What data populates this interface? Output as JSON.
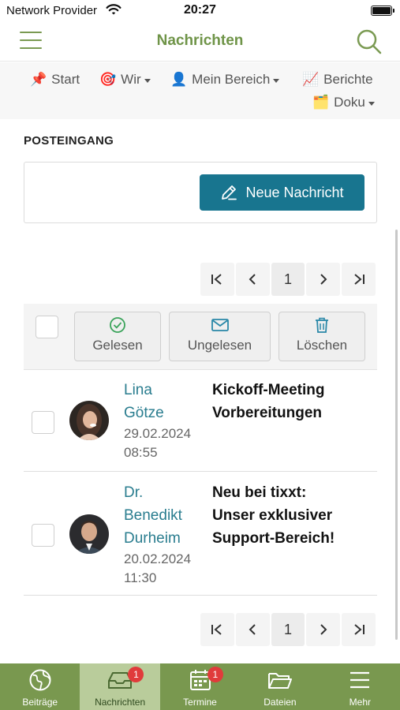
{
  "status_bar": {
    "carrier": "Network Provider",
    "time": "20:27"
  },
  "header": {
    "title": "Nachrichten",
    "menu_icon": "hamburger-icon",
    "search_icon": "search-icon"
  },
  "top_nav": [
    {
      "emoji": "📌",
      "label": "Start",
      "dropdown": false
    },
    {
      "emoji": "🎯",
      "label": "Wir",
      "dropdown": true
    },
    {
      "emoji": "👤",
      "label": "Mein Bereich",
      "dropdown": true
    },
    {
      "emoji": "📈",
      "label": "Berichte",
      "dropdown": false
    },
    {
      "emoji": "🗂️",
      "label": "Doku",
      "dropdown": true
    }
  ],
  "inbox": {
    "title": "POSTEINGANG",
    "new_message_label": "Neue Nachricht",
    "current_page": "1",
    "actions": {
      "read": "Gelesen",
      "unread": "Ungelesen",
      "delete": "Löschen"
    },
    "messages": [
      {
        "sender_line1": "Lina",
        "sender_line2": "Götze",
        "sender_line3": "",
        "date": "29.02.2024",
        "time": "08:55",
        "subject_line1": "Kickoff-Meeting",
        "subject_line2": "Vorbereitungen",
        "subject_line3": ""
      },
      {
        "sender_line1": "Dr.",
        "sender_line2": "Benedikt",
        "sender_line3": "Durheim",
        "date": "20.02.2024",
        "time": "11:30",
        "subject_line1": "Neu bei tixxt:",
        "subject_line2": "Unser exklusiver",
        "subject_line3": "Support-Bereich!"
      }
    ]
  },
  "tab_bar": [
    {
      "label": "Beiträge",
      "icon": "globe-icon",
      "badge": ""
    },
    {
      "label": "Nachrichten",
      "icon": "inbox-icon",
      "badge": "1"
    },
    {
      "label": "Termine",
      "icon": "calendar-icon",
      "badge": "1"
    },
    {
      "label": "Dateien",
      "icon": "folder-icon",
      "badge": ""
    },
    {
      "label": "Mehr",
      "icon": "menu-icon",
      "badge": ""
    }
  ],
  "colors": {
    "accent_green": "#79984f",
    "primary_button": "#18758f",
    "badge_red": "#e03b3b"
  }
}
